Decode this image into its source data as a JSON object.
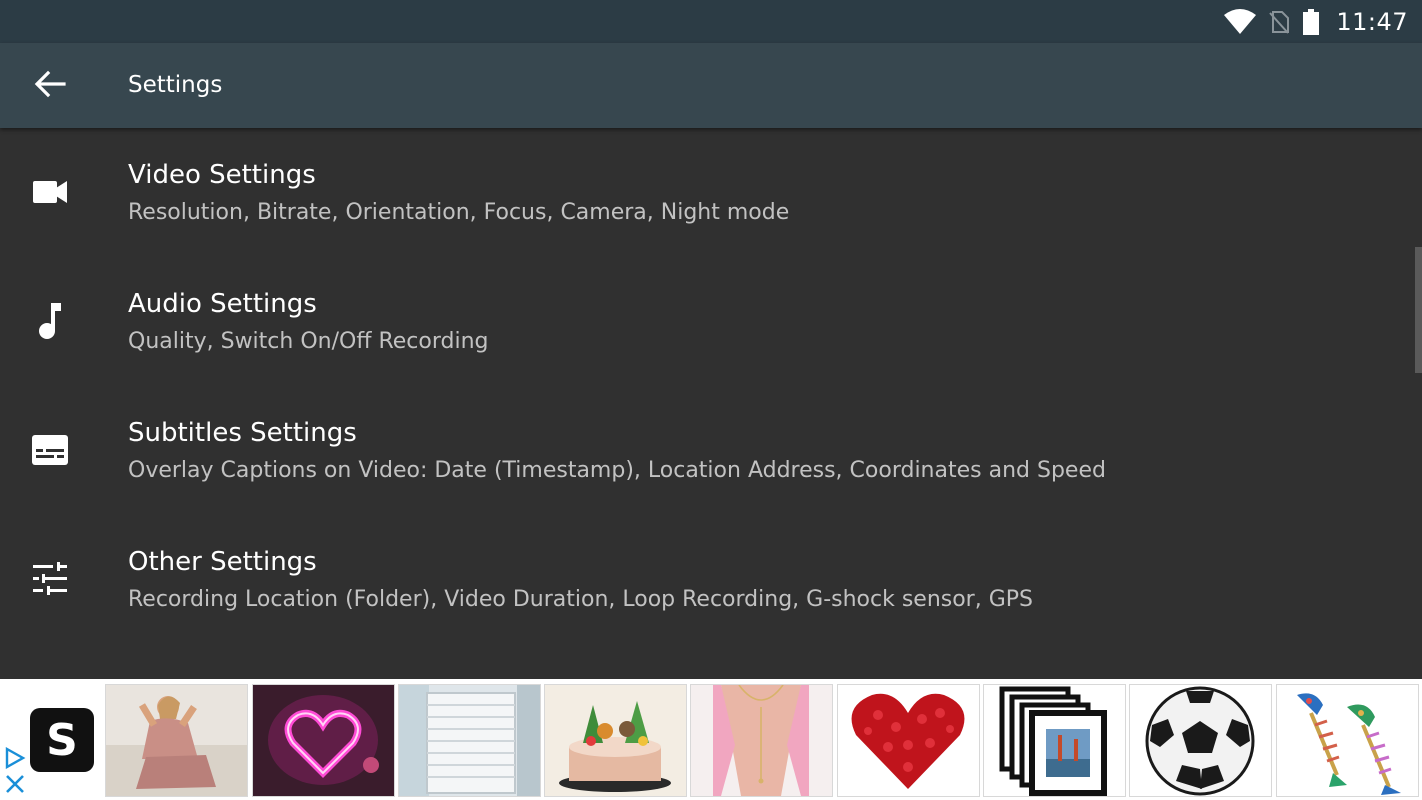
{
  "status_bar": {
    "time": "11:47"
  },
  "app_bar": {
    "title": "Settings"
  },
  "settings_items": [
    {
      "title": "Video Settings",
      "subtitle": "Resolution, Bitrate, Orientation, Focus, Camera, Night mode",
      "icon": "video-camera-icon"
    },
    {
      "title": "Audio Settings",
      "subtitle": "Quality, Switch On/Off Recording",
      "icon": "music-note-icon"
    },
    {
      "title": "Subtitles Settings",
      "subtitle": "Overlay Captions on Video: Date (Timestamp), Location Address, Coordinates and Speed",
      "icon": "subtitles-icon"
    },
    {
      "title": "Other Settings",
      "subtitle": "Recording Location (Folder), Video Duration, Loop Recording, G-shock sensor, GPS",
      "icon": "tune-icon"
    }
  ],
  "ad": {
    "logo_letter": "S",
    "products": [
      "pajama-set",
      "neon-heart-light",
      "towel-radiator",
      "animal-birthday-cake",
      "body-chain-necklace",
      "rose-petal-heart",
      "photo-frames",
      "soccer-ball-rug",
      "fish-earrings"
    ]
  },
  "colors": {
    "status_bar": "#2c3c45",
    "app_bar": "#37474f",
    "background": "#303030",
    "subtitle_text": "#c2c2c2"
  }
}
